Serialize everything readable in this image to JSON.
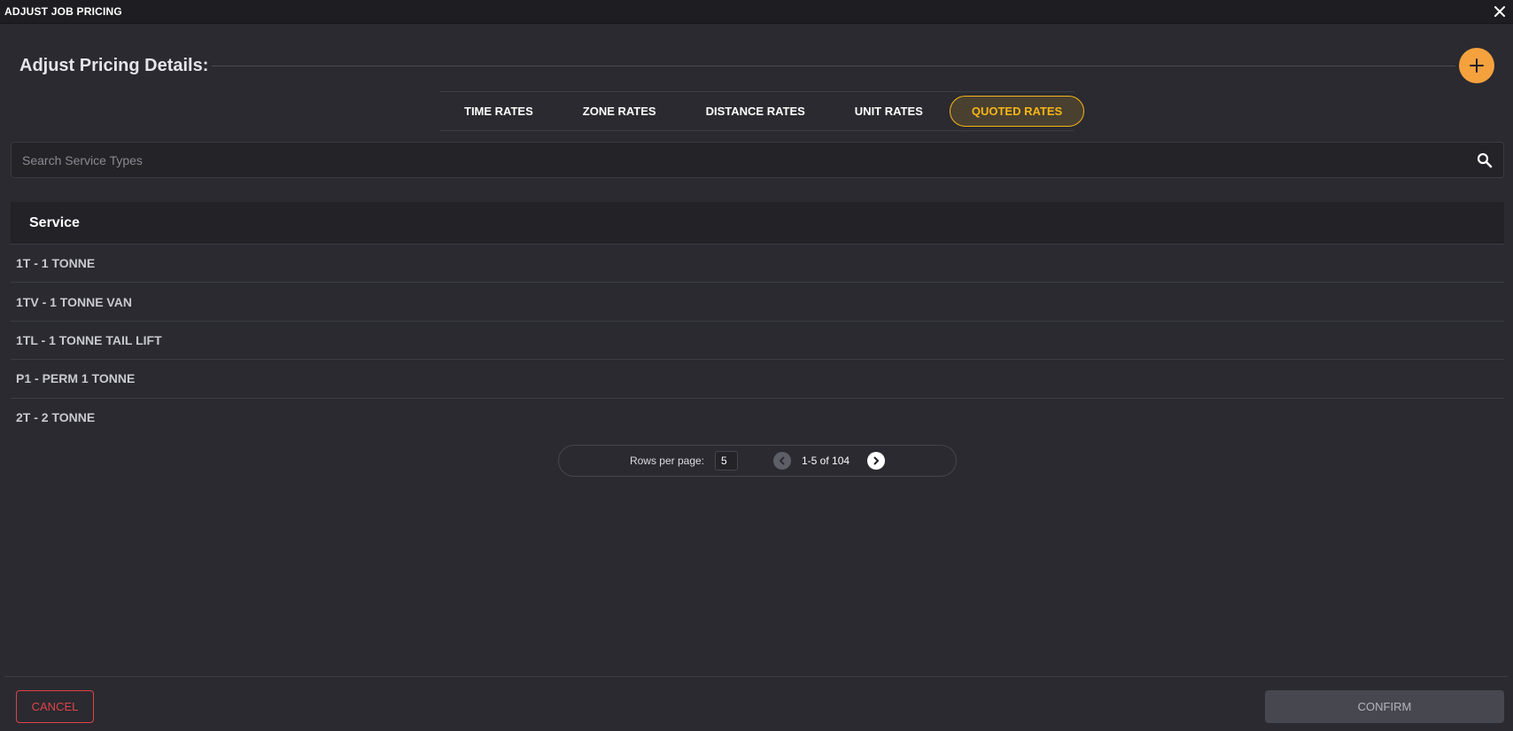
{
  "window": {
    "title": "ADJUST JOB PRICING",
    "close_icon": "close-icon"
  },
  "header": {
    "heading": "Adjust Pricing Details:",
    "add_icon": "plus-icon",
    "accent_color": "#f5a13e"
  },
  "tabs": [
    {
      "label": "TIME RATES",
      "active": false
    },
    {
      "label": "ZONE RATES",
      "active": false
    },
    {
      "label": "DISTANCE RATES",
      "active": false
    },
    {
      "label": "UNIT RATES",
      "active": false
    },
    {
      "label": "QUOTED RATES",
      "active": true
    }
  ],
  "tab_active_color": "#f7b617",
  "search": {
    "placeholder": "Search Service Types",
    "value": "",
    "icon": "search-icon"
  },
  "table": {
    "header": "Service",
    "rows": [
      "1T - 1 TONNE",
      "1TV - 1 TONNE VAN",
      "1TL - 1 TONNE TAIL LIFT",
      "P1 - PERM 1 TONNE",
      "2T - 2 TONNE"
    ]
  },
  "pagination": {
    "rows_per_page_label": "Rows per page:",
    "rows_per_page": "5",
    "range": "1-5 of 104",
    "prev_icon": "chevron-left-icon",
    "next_icon": "chevron-right-icon"
  },
  "footer": {
    "cancel_label": "CANCEL",
    "confirm_label": "CONFIRM",
    "cancel_color": "#e0434b"
  }
}
